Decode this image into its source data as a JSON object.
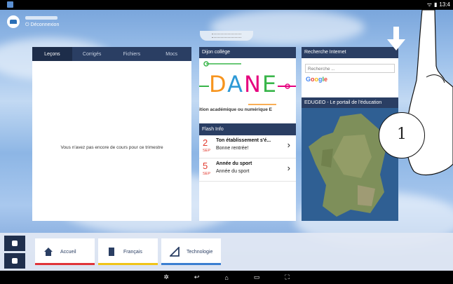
{
  "status": {
    "time": "13:4"
  },
  "header": {
    "logout_label": "Déconnexion"
  },
  "lessons": {
    "tabs": [
      "Leçons",
      "Corrigés",
      "Fichiers",
      "Mocs"
    ],
    "active_tab": "Leçons",
    "empty_message": "Vous n'avez pas encore de cours pour ce trimestre"
  },
  "dijon": {
    "title": "Dijon collège",
    "logo_text": "DANE",
    "subtitle": "ition académique ou numérique E"
  },
  "flash": {
    "title": "Flash Info",
    "items": [
      {
        "day": "2",
        "month": "SEP",
        "title": "Ton établissement s'é...",
        "text": "Bonne rentrée!"
      },
      {
        "day": "5",
        "month": "SEP",
        "title": "Année du sport",
        "text": "Année du sport"
      }
    ]
  },
  "search": {
    "title": "Recherche Internet",
    "placeholder": "Recherche ...",
    "engine": "Google"
  },
  "edugeo": {
    "title": "EDUGEO - Le portail de l'éducation"
  },
  "annotation": {
    "step": "1"
  },
  "subjects": [
    {
      "label": "Accueil",
      "color": "#e0343a"
    },
    {
      "label": "Français",
      "color": "#f0c419"
    },
    {
      "label": "Technologie",
      "color": "#3b7fd1"
    }
  ],
  "colors": {
    "header": "#2a3e63",
    "accent_red": "#e23b2f"
  }
}
